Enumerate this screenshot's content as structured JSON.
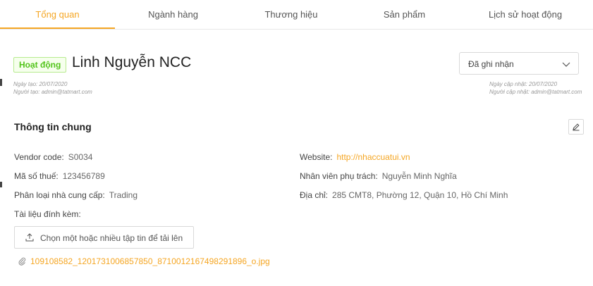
{
  "tabs": [
    {
      "label": "Tổng quan",
      "active": true
    },
    {
      "label": "Ngành hàng",
      "active": false
    },
    {
      "label": "Thương hiệu",
      "active": false
    },
    {
      "label": "Sản phẩm",
      "active": false
    },
    {
      "label": "Lịch sử hoạt động",
      "active": false
    }
  ],
  "header": {
    "status_tag": "Hoạt động",
    "vendor_name": "Linh Nguyễn NCC",
    "created_date": "Ngày tạo: 20/07/2020",
    "created_by": "Người tạo: admin@tatmart.com",
    "updated_date": "Ngày cập nhật: 20/07/2020",
    "updated_by": "Người cập nhật: admin@tatmart.com",
    "status_select": {
      "value": "Đã ghi nhận",
      "icon": "chevron-down-icon"
    }
  },
  "section": {
    "title": "Thông tin chung",
    "edit_icon": "edit-icon",
    "vendor_code": {
      "label": "Vendor code:",
      "value": "S0034"
    },
    "tax_code": {
      "label": "Mã số thuế:",
      "value": "123456789"
    },
    "vendor_type": {
      "label": "Phân loại nhà cung cấp:",
      "value": "Trading"
    },
    "website": {
      "label": "Website:",
      "value": "http://nhaccuatui.vn"
    },
    "staff": {
      "label": "Nhân viên phụ trách:",
      "value": "Nguyễn Minh Nghĩa"
    },
    "address": {
      "label": "Địa chỉ:",
      "value": "285 CMT8, Phường 12, Quận 10, Hồ Chí Minh"
    },
    "attachments_label": "Tài liệu đính kèm:",
    "upload_label": "Chọn một hoặc nhiều tập tin để tải lên",
    "upload_icon": "upload-icon",
    "attachment_file": "109108582_1201731006857850_8710012167498291896_o.jpg",
    "attachment_icon": "paperclip-icon"
  },
  "colors": {
    "accent": "#f5a623",
    "success": "#52c41a",
    "success_bg": "#f6ffed"
  }
}
